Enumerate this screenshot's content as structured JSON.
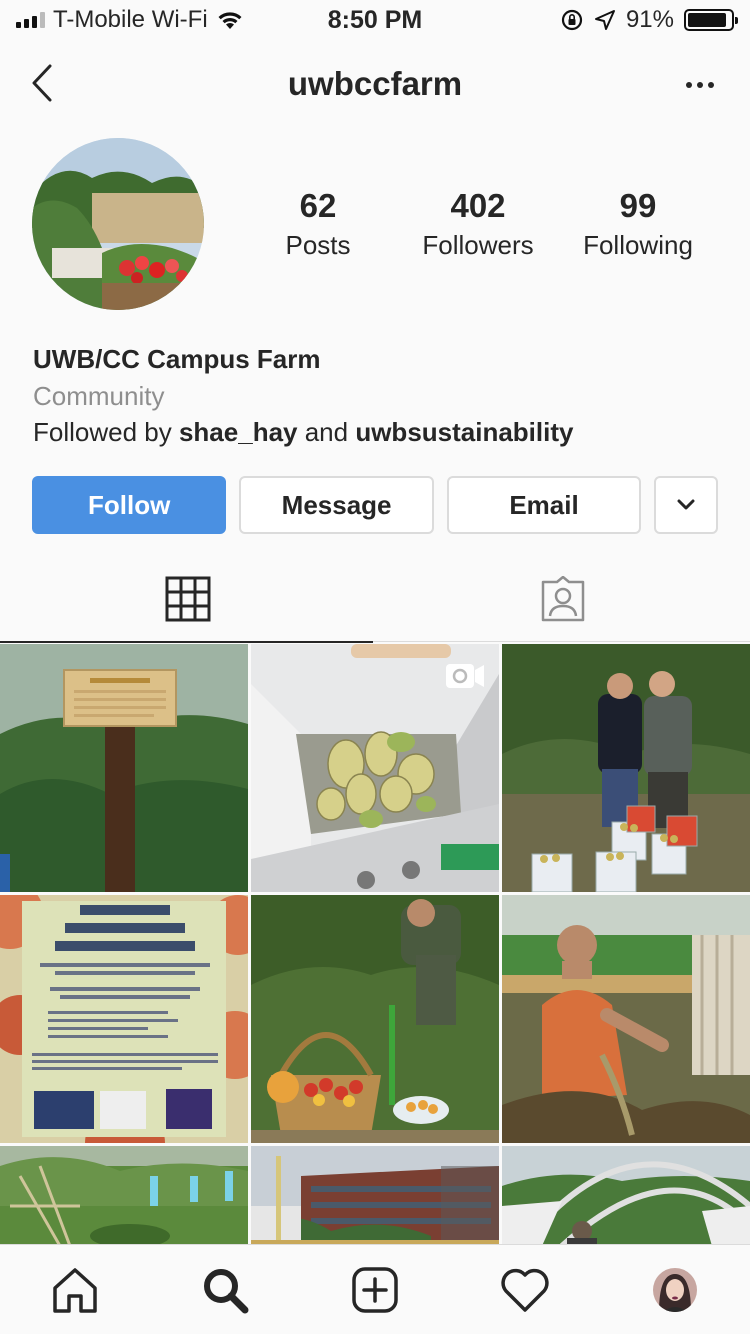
{
  "status_bar": {
    "carrier": "T-Mobile Wi-Fi",
    "time": "8:50 PM",
    "battery_percent": "91%",
    "battery_level": 0.91,
    "icons": [
      "signal-icon",
      "wifi-icon",
      "orientation-lock-icon",
      "location-icon",
      "battery-icon"
    ]
  },
  "header": {
    "username": "uwbccfarm",
    "back_icon": "chevron-left-icon",
    "more_icon": "more-horizontal-icon"
  },
  "profile": {
    "stats": [
      {
        "value": "62",
        "label": "Posts"
      },
      {
        "value": "402",
        "label": "Followers"
      },
      {
        "value": "99",
        "label": "Following"
      }
    ],
    "name": "UWB/CC Campus Farm",
    "category": "Community",
    "followed_by_prefix": "Followed by ",
    "followed_by_user1": "shae_hay",
    "followed_by_conj": " and ",
    "followed_by_user2": "uwbsustainability"
  },
  "actions": {
    "follow_label": "Follow",
    "message_label": "Message",
    "email_label": "Email",
    "dropdown_icon": "chevron-down-icon",
    "follow_color": "#4a90e2"
  },
  "tabs": {
    "items": [
      "grid-icon",
      "tagged-photos-icon"
    ],
    "active": 0
  },
  "bottom_nav": {
    "items": [
      "home-icon",
      "search-icon",
      "new-post-icon",
      "activity-heart-icon",
      "profile-avatar"
    ]
  }
}
